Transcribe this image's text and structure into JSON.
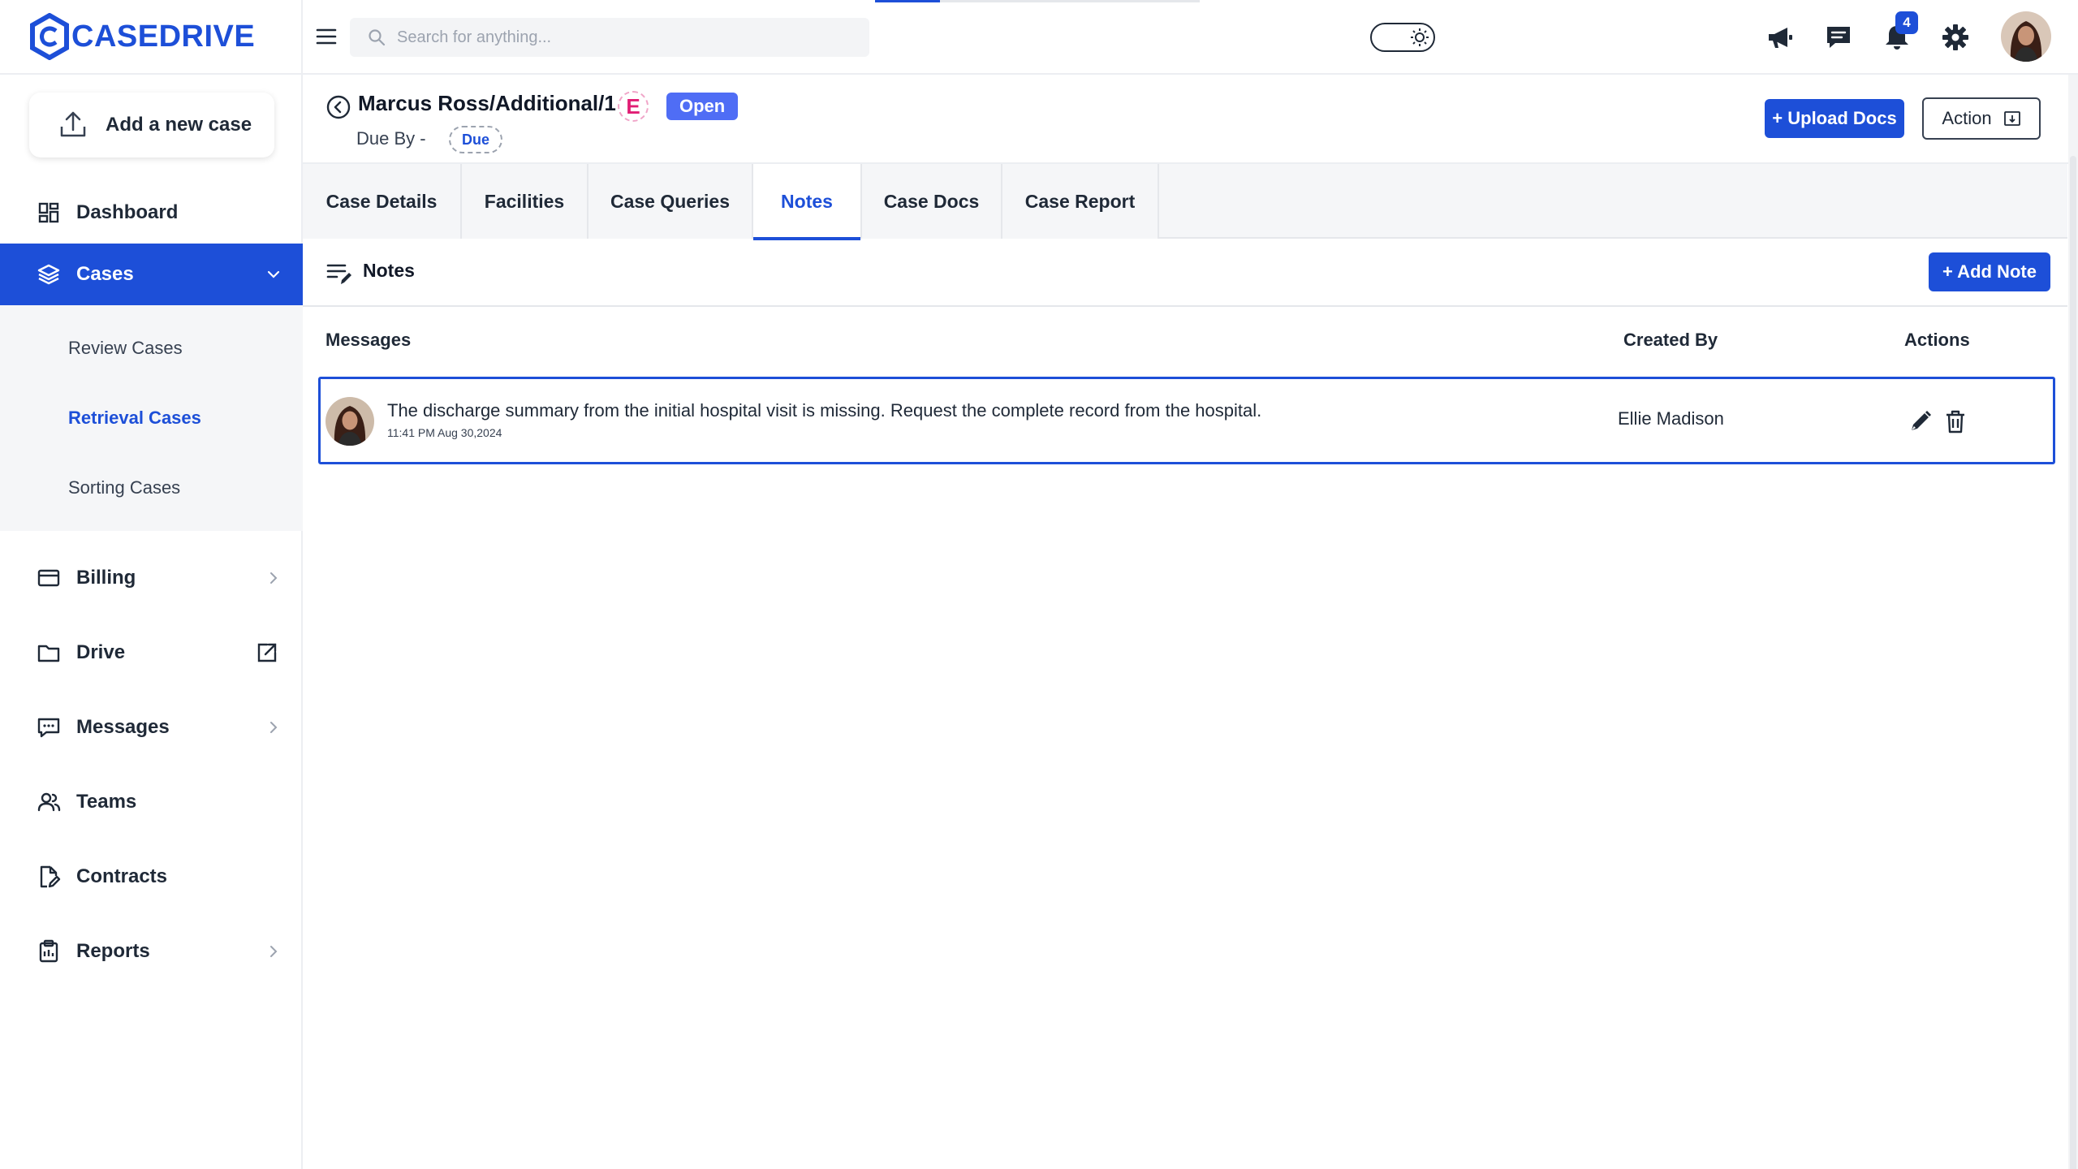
{
  "brand": {
    "name": "CASEDRIVE"
  },
  "sidebar": {
    "add_case_label": "Add a new case",
    "items": [
      {
        "label": "Dashboard"
      },
      {
        "label": "Cases"
      },
      {
        "label": "Billing"
      },
      {
        "label": "Drive"
      },
      {
        "label": "Messages"
      },
      {
        "label": "Teams"
      },
      {
        "label": "Contracts"
      },
      {
        "label": "Reports"
      }
    ],
    "cases_sub": [
      {
        "label": "Review Cases"
      },
      {
        "label": "Retrieval Cases"
      },
      {
        "label": "Sorting Cases"
      }
    ]
  },
  "topbar": {
    "search_placeholder": "Search for anything...",
    "notification_count": "4"
  },
  "case": {
    "title": "Marcus Ross/Additional/1",
    "badge_letter": "E",
    "status": "Open",
    "due_by_label": "Due By -",
    "due_pill": "Due",
    "upload_label": "+ Upload Docs",
    "action_label": "Action"
  },
  "tabs": [
    {
      "label": "Case Details"
    },
    {
      "label": "Facilities"
    },
    {
      "label": "Case Queries"
    },
    {
      "label": "Notes"
    },
    {
      "label": "Case Docs"
    },
    {
      "label": "Case Report"
    }
  ],
  "notes": {
    "title": "Notes",
    "add_label": "+ Add Note",
    "columns": {
      "messages": "Messages",
      "created_by": "Created By",
      "actions": "Actions"
    },
    "rows": [
      {
        "message": "The discharge summary from the initial hospital visit is missing. Request the complete record from the hospital.",
        "time": "11:41 PM Aug 30,2024",
        "created_by": "Ellie Madison"
      }
    ]
  },
  "colors": {
    "accent": "#1d4fd8",
    "status_open": "#4f6df5",
    "e_badge": "#e11d74"
  }
}
